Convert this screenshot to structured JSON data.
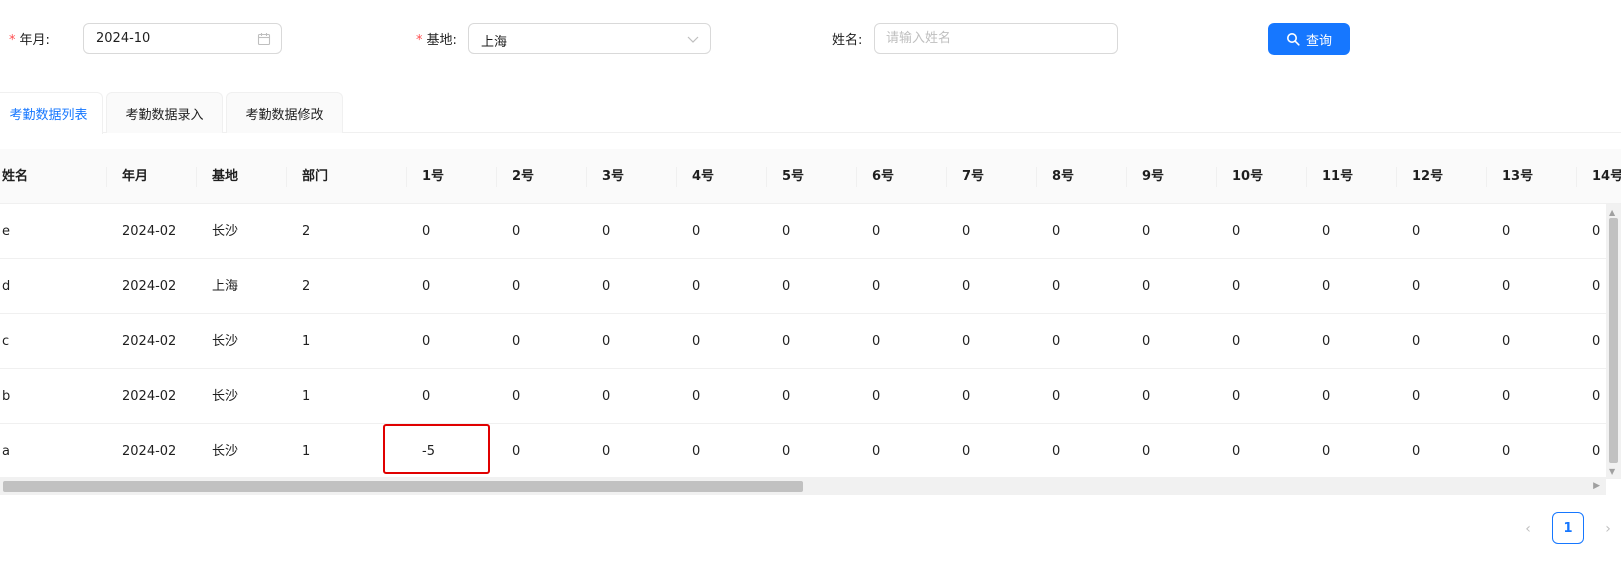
{
  "filters": {
    "month_label": "年月:",
    "month_value": "2024-10",
    "base_label": "基地:",
    "base_value": "上海",
    "name_label": "姓名:",
    "name_placeholder": "请输入姓名",
    "required_mark": "*",
    "query_label": "查询"
  },
  "tabs": [
    {
      "label": "考勤数据列表",
      "active": true
    },
    {
      "label": "考勤数据录入",
      "active": false
    },
    {
      "label": "考勤数据修改",
      "active": false
    }
  ],
  "table": {
    "columns": [
      "姓名",
      "年月",
      "基地",
      "部门",
      "1号",
      "2号",
      "3号",
      "4号",
      "5号",
      "6号",
      "7号",
      "8号",
      "9号",
      "10号",
      "11号",
      "12号",
      "13号",
      "14号"
    ],
    "rows": [
      [
        "e",
        "2024-02",
        "长沙",
        "2",
        "0",
        "0",
        "0",
        "0",
        "0",
        "0",
        "0",
        "0",
        "0",
        "0",
        "0",
        "0",
        "0",
        "0"
      ],
      [
        "d",
        "2024-02",
        "上海",
        "2",
        "0",
        "0",
        "0",
        "0",
        "0",
        "0",
        "0",
        "0",
        "0",
        "0",
        "0",
        "0",
        "0",
        "0"
      ],
      [
        "c",
        "2024-02",
        "长沙",
        "1",
        "0",
        "0",
        "0",
        "0",
        "0",
        "0",
        "0",
        "0",
        "0",
        "0",
        "0",
        "0",
        "0",
        "0"
      ],
      [
        "b",
        "2024-02",
        "长沙",
        "1",
        "0",
        "0",
        "0",
        "0",
        "0",
        "0",
        "0",
        "0",
        "0",
        "0",
        "0",
        "0",
        "0",
        "0"
      ],
      [
        "a",
        "2024-02",
        "长沙",
        "1",
        "-5",
        "0",
        "0",
        "0",
        "0",
        "0",
        "0",
        "0",
        "0",
        "0",
        "0",
        "0",
        "0",
        "0"
      ]
    ]
  },
  "pagination": {
    "current_page": "1"
  },
  "colors": {
    "primary": "#1677ff",
    "required": "#ff4d4f",
    "highlight": "#e00000"
  },
  "icons": {
    "month_suffix": "calendar-icon",
    "base_suffix": "chevron-down-icon",
    "query": "search-icon"
  }
}
